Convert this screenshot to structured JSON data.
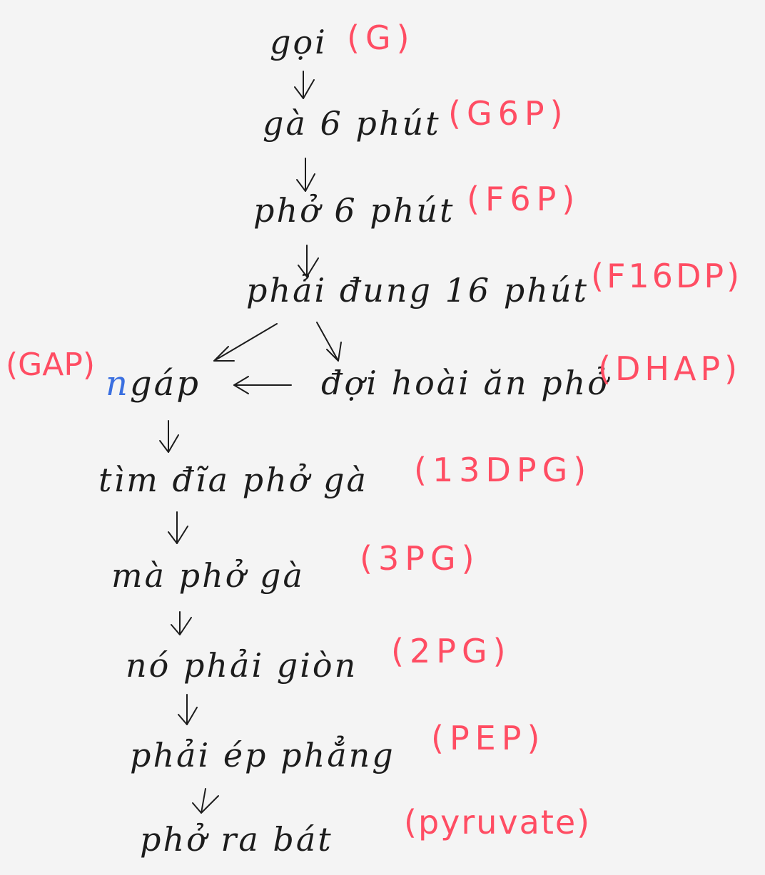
{
  "steps": [
    {
      "key": "g",
      "text": "gọi",
      "label": "(G)"
    },
    {
      "key": "g6p",
      "text": "gà 6 phút",
      "label": "(G6P)"
    },
    {
      "key": "f6p",
      "text": "phở 6 phút",
      "label": "(F6P)"
    },
    {
      "key": "f16dp",
      "text": "phải đung 16 phút",
      "label": "(F16DP)"
    },
    {
      "key": "dhap",
      "text": "đợi hoài ăn phở",
      "label": "(DHAP)"
    },
    {
      "key": "bpg13",
      "text": "tìm đĩa phở gà",
      "label": "(13DPG)"
    },
    {
      "key": "pg3",
      "text": "mà phở gà",
      "label": "(3PG)"
    },
    {
      "key": "pg2",
      "text": "nó phải giòn",
      "label": "(2PG)"
    },
    {
      "key": "pep",
      "text": "phải ép phẳng",
      "label": "(PEP)"
    },
    {
      "key": "pyruvate",
      "text": "phở ra bát",
      "label": "(pyruvate)"
    }
  ],
  "gap": {
    "label": "(GAP)",
    "text_initial": "n",
    "text_rest": "gáp"
  },
  "colors": {
    "ink": "#1c1c1c",
    "label": "#ff4d63",
    "highlight": "#3a6fe0",
    "paper": "#f4f4f4"
  }
}
